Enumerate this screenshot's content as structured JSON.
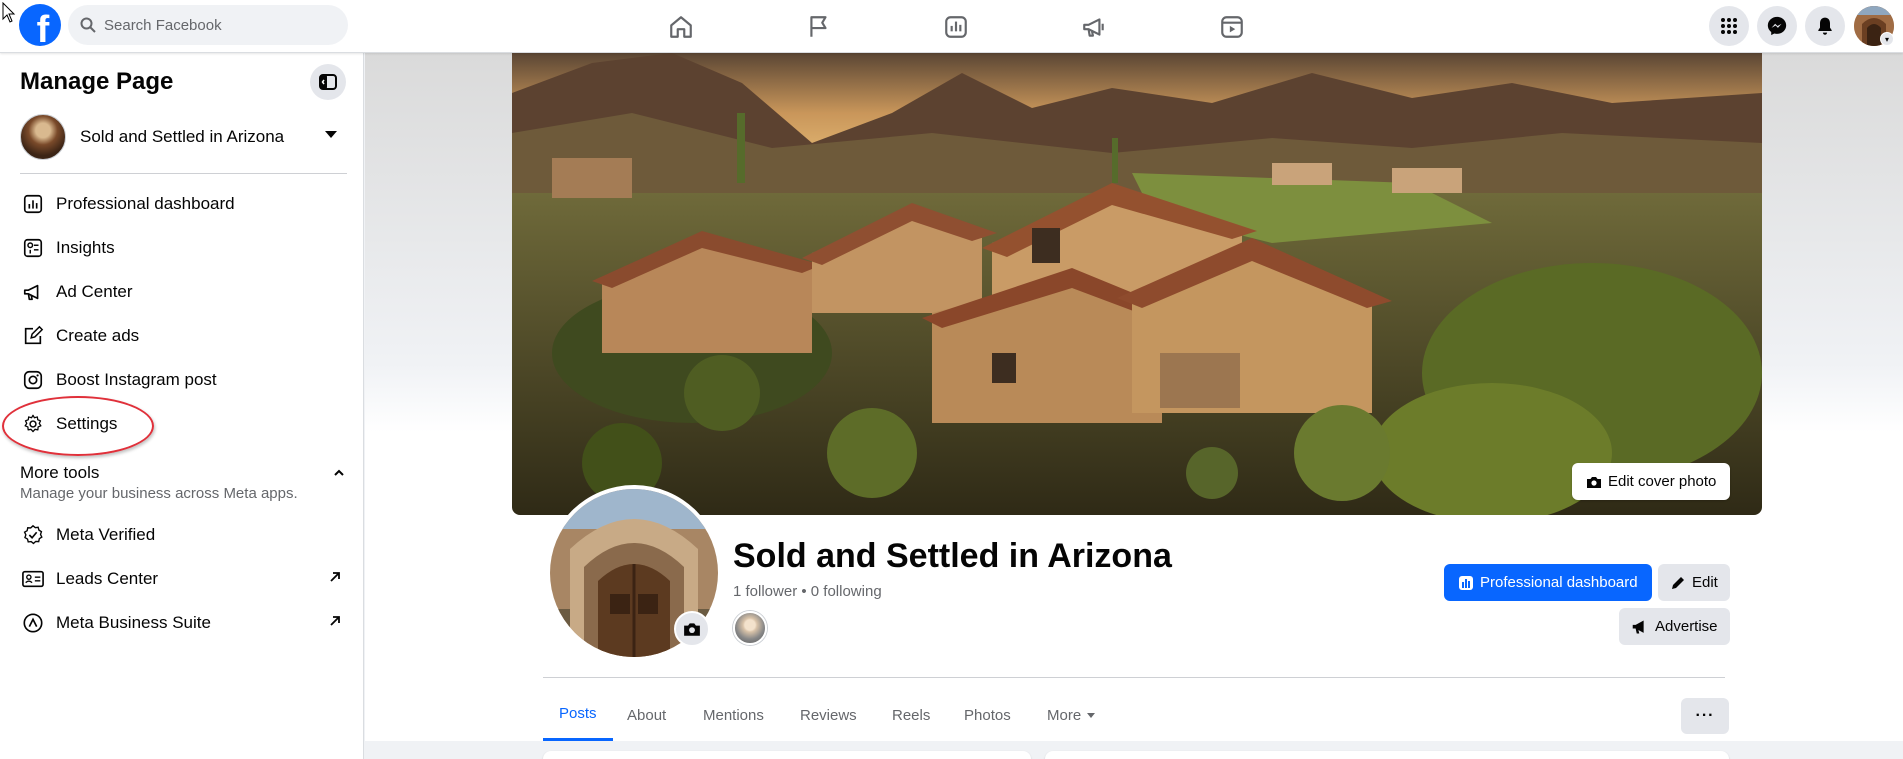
{
  "topbar": {
    "search_placeholder": "Search Facebook",
    "logo_letter": "f",
    "nav_icons": [
      "home-icon",
      "flag-icon",
      "dashboard-icon",
      "megaphone-icon",
      "video-icon"
    ],
    "right_icons": [
      "menu-grid-icon",
      "messenger-icon",
      "notifications-icon"
    ]
  },
  "sidebar": {
    "title": "Manage Page",
    "page_name": "Sold and Settled in Arizona",
    "items": [
      {
        "label": "Professional dashboard",
        "icon": "dashboard-icon"
      },
      {
        "label": "Insights",
        "icon": "insights-icon"
      },
      {
        "label": "Ad Center",
        "icon": "megaphone-icon"
      },
      {
        "label": "Create ads",
        "icon": "edit-icon"
      },
      {
        "label": "Boost Instagram post",
        "icon": "instagram-icon"
      },
      {
        "label": "Settings",
        "icon": "gear-icon"
      }
    ],
    "more_tools": {
      "title": "More tools",
      "subtitle": "Manage your business across Meta apps."
    },
    "tools": [
      {
        "label": "Meta Verified",
        "icon": "verified-icon"
      },
      {
        "label": "Leads Center",
        "icon": "leads-icon"
      },
      {
        "label": "Meta Business Suite",
        "icon": "business-suite-icon"
      }
    ]
  },
  "profile": {
    "edit_cover_label": "Edit cover photo",
    "page_title": "Sold and Settled in Arizona",
    "stats": "1 follower • 0 following",
    "buttons": {
      "professional_dashboard": "Professional dashboard",
      "edit": "Edit",
      "advertise": "Advertise"
    },
    "tabs": [
      "Posts",
      "About",
      "Mentions",
      "Reviews",
      "Reels",
      "Photos",
      "More"
    ],
    "more_dots": "···"
  },
  "colors": {
    "accent": "#0866ff",
    "annotation_circle": "#e0303a",
    "secondary_bg": "#e4e6eb"
  }
}
